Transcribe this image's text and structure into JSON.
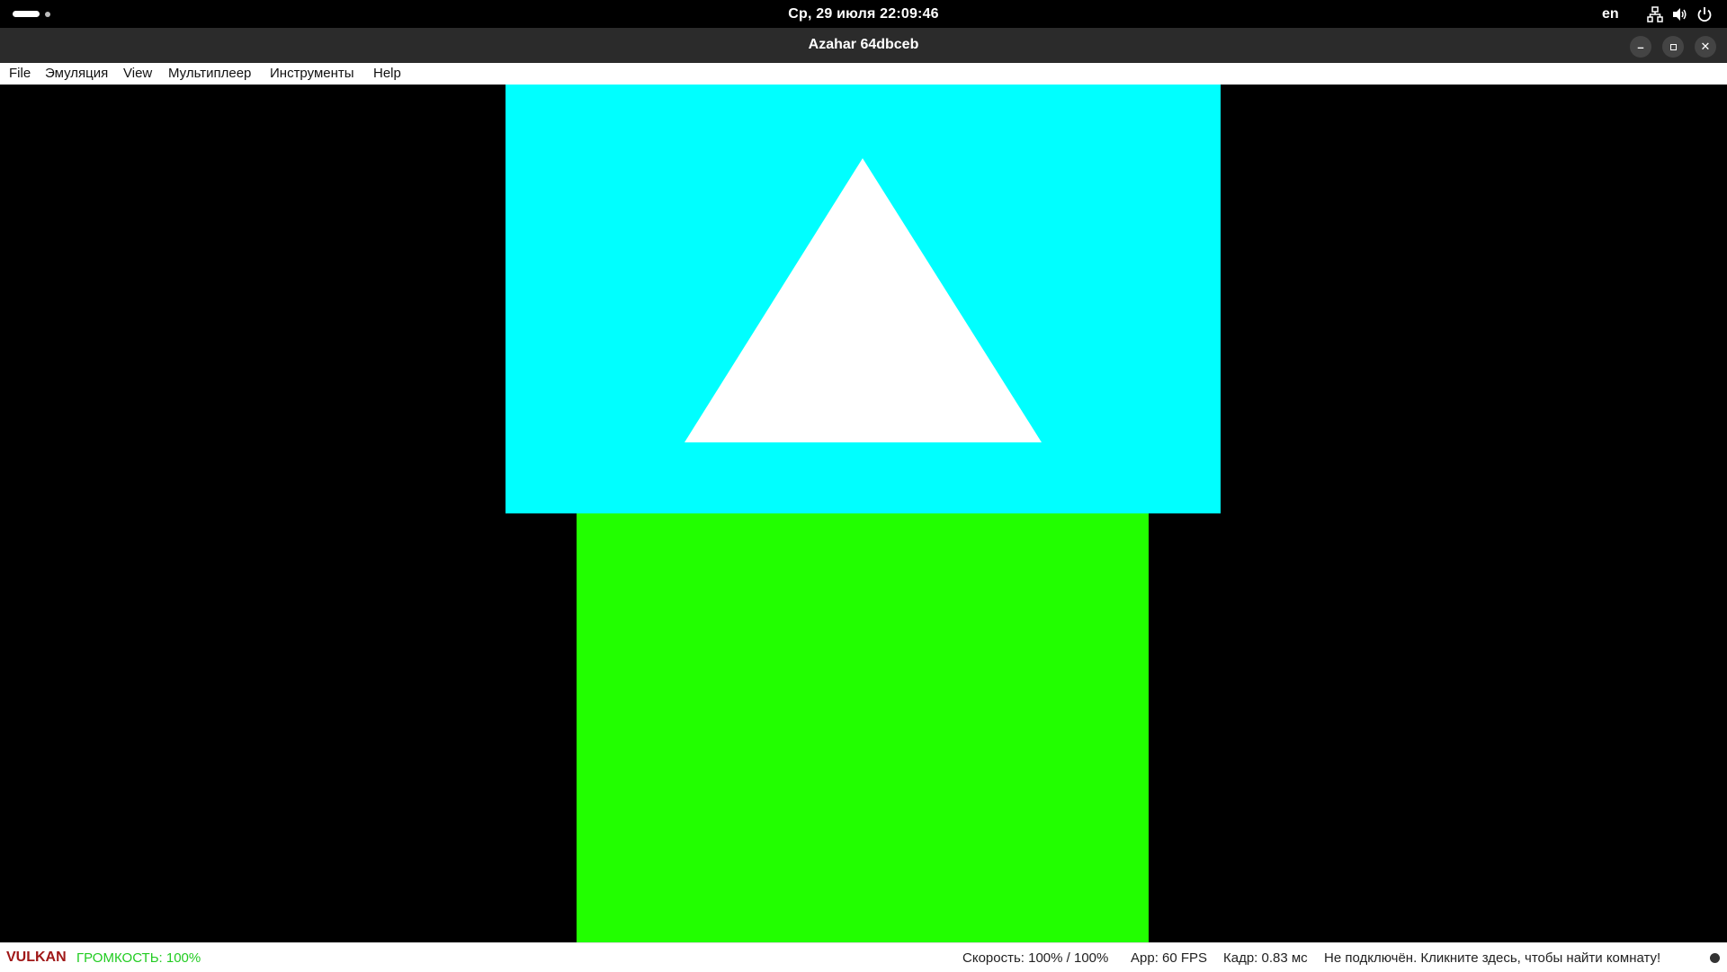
{
  "topbar": {
    "datetime": "Ср, 29 июля  22:09:46",
    "lang": "en",
    "icons": [
      "activities-icon",
      "network-icon",
      "volume-icon",
      "power-icon"
    ]
  },
  "window": {
    "title": "Azahar 64dbceb",
    "buttons": [
      "minimize-icon",
      "maximize-icon",
      "close-icon"
    ]
  },
  "menubar": {
    "items": [
      "File",
      "Эмуляция",
      "View",
      "Мультиплеер",
      "Инструменты",
      "Help"
    ]
  },
  "screens": {
    "top_color": "#00ffff",
    "triangle_color": "#ffffff",
    "bottom_color": "#22ff00",
    "background": "#000000"
  },
  "status": {
    "renderer": "VULKAN",
    "renderer_color": "#a01818",
    "volume": "ГРОМКОСТЬ: 100%",
    "volume_color": "#22cc22",
    "speed": "Скорость: 100% / 100%",
    "fps": "App: 60 FPS",
    "frame": "Кадр: 0.83 мс",
    "network": "Не подключён. Кликните здесь, чтобы найти комнату!"
  }
}
